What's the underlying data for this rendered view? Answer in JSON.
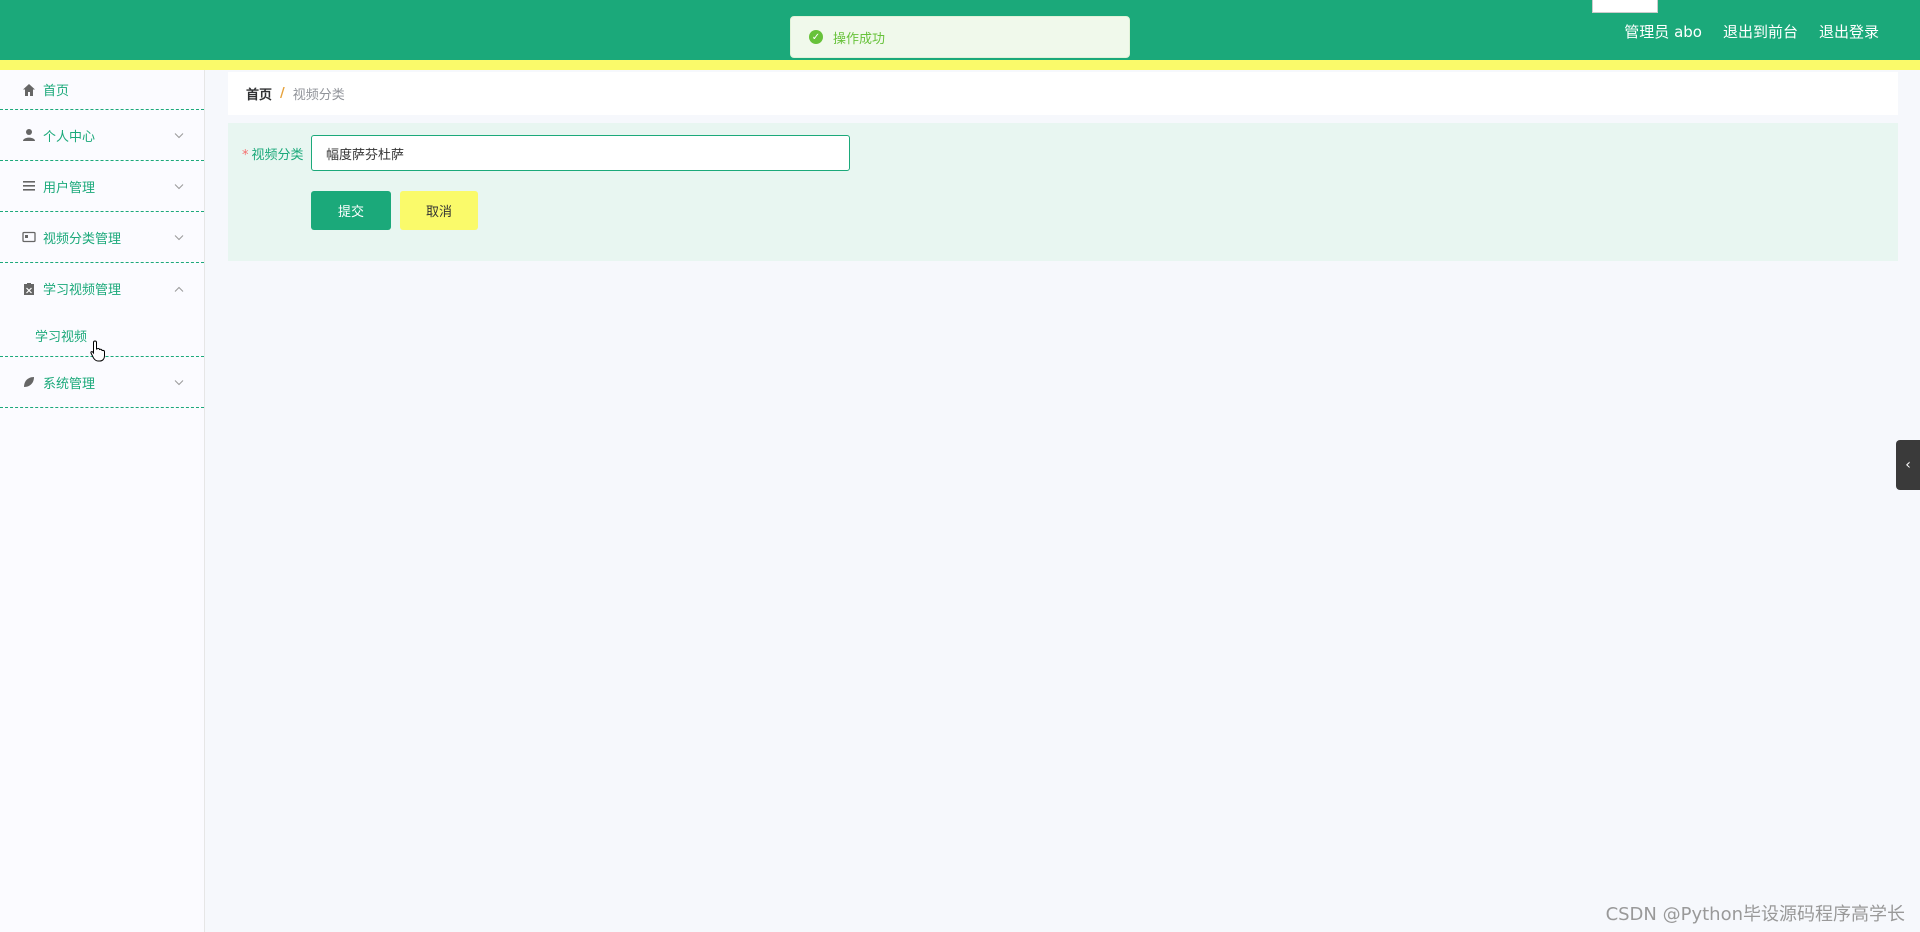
{
  "header": {
    "actions": [
      "管理员 abo",
      "退出到前台",
      "退出登录"
    ]
  },
  "toast": {
    "text": "操作成功"
  },
  "sidebar": {
    "items": [
      {
        "label": "首页",
        "icon": "home-icon"
      },
      {
        "label": "个人中心",
        "icon": "user-icon"
      },
      {
        "label": "用户管理",
        "icon": "list-icon"
      },
      {
        "label": "视频分类管理",
        "icon": "card-icon"
      },
      {
        "label": "学习视频管理",
        "icon": "clipboard-icon",
        "expanded": true,
        "children": [
          {
            "label": "学习视频"
          }
        ]
      },
      {
        "label": "系统管理",
        "icon": "leaf-icon"
      }
    ]
  },
  "breadcrumb": {
    "home": "首页",
    "separator": "/",
    "current": "视频分类"
  },
  "form": {
    "label": "视频分类",
    "required_mark": "*",
    "value": "幅度萨芬杜萨",
    "submit": "提交",
    "cancel": "取消"
  },
  "watermark": "CSDN @Python毕设源码程序高学长",
  "colors": {
    "primary": "#1ba97a",
    "accent_yellow": "#fafa6a",
    "success": "#67c23a"
  }
}
